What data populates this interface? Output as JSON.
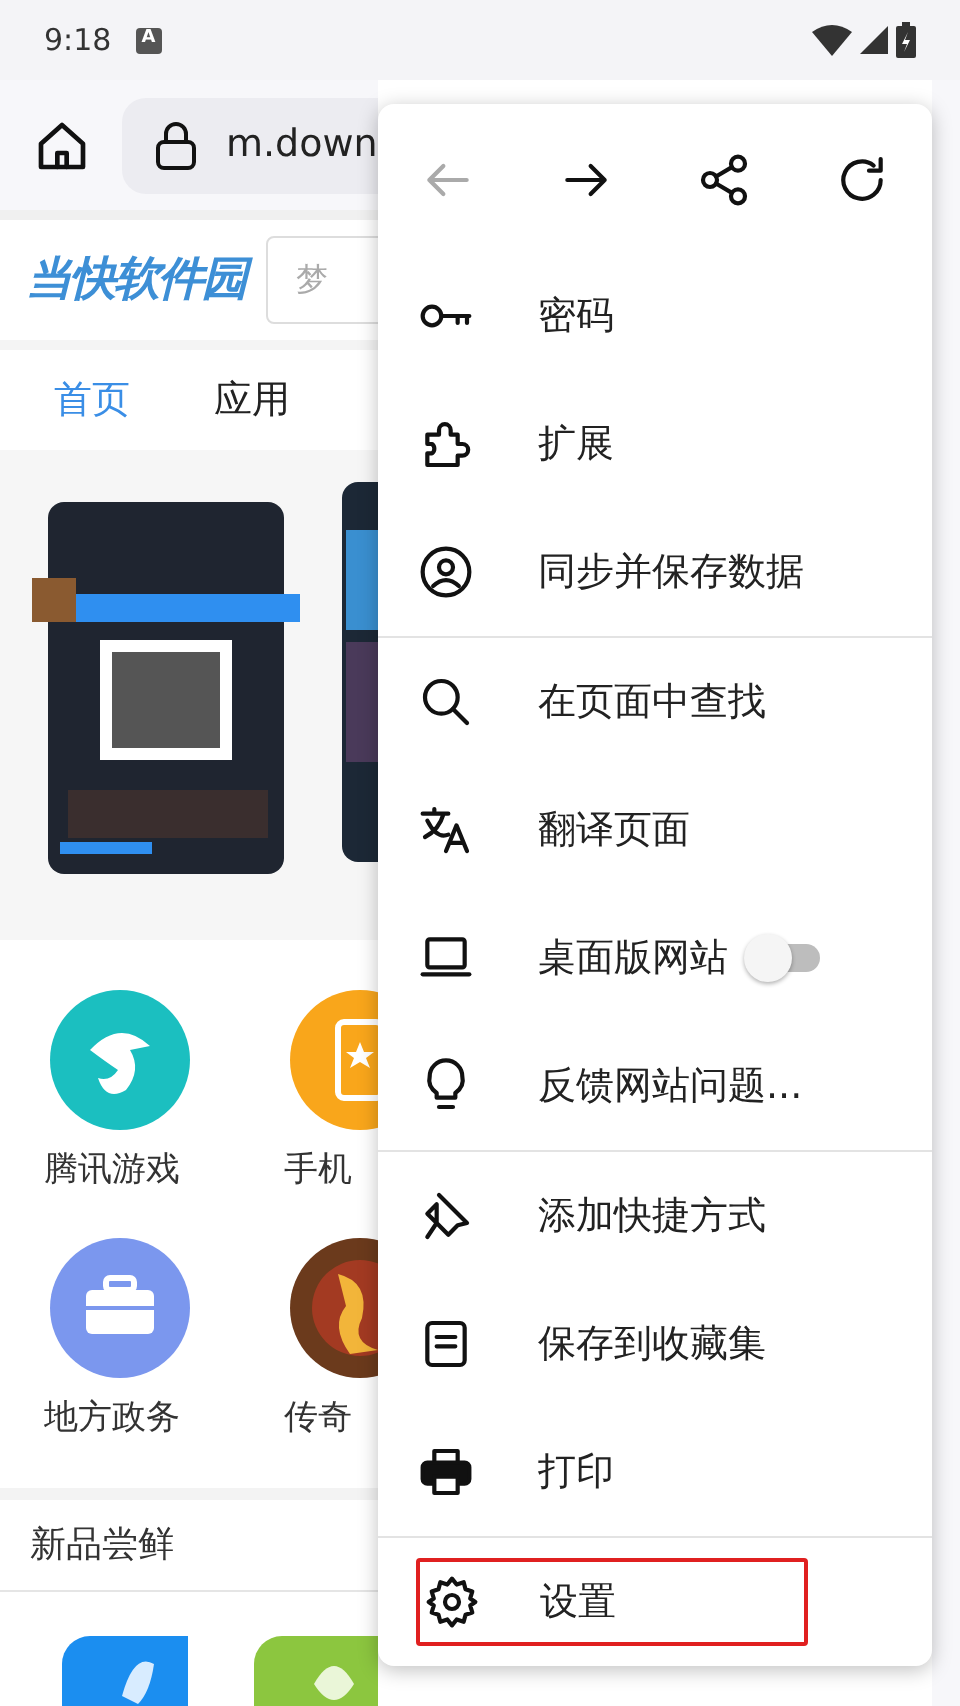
{
  "status_bar": {
    "time": "9:18",
    "notification": "A"
  },
  "toolbar": {
    "url": "m.down"
  },
  "site": {
    "logo": "当快软件园",
    "search_placeholder": "梦"
  },
  "tabs": [
    {
      "label": "首页",
      "selected": true
    },
    {
      "label": "应用",
      "selected": false
    }
  ],
  "categories": [
    {
      "label": "腾讯游戏",
      "color": "#1bbfc0",
      "kind": "fish"
    },
    {
      "label": "手机",
      "color": "#f9a61b",
      "kind": "phone"
    },
    {
      "label": "地方政务",
      "color": "#7b97ee",
      "kind": "briefcase"
    },
    {
      "label": "传奇",
      "color": "#6b3a1c",
      "kind": "picture"
    }
  ],
  "section_title": "新品尝鲜",
  "menu": {
    "nav": [
      {
        "kind": "back",
        "disabled": true
      },
      {
        "kind": "forward",
        "disabled": false
      },
      {
        "kind": "share",
        "disabled": false
      },
      {
        "kind": "reload",
        "disabled": false
      }
    ],
    "groups": [
      [
        {
          "kind": "key",
          "label": "密码"
        },
        {
          "kind": "puzzle",
          "label": "扩展"
        },
        {
          "kind": "account",
          "label": "同步并保存数据"
        }
      ],
      [
        {
          "kind": "search",
          "label": "在页面中查找"
        },
        {
          "kind": "translate",
          "label": "翻译页面"
        },
        {
          "kind": "laptop",
          "label": "桌面版网站",
          "toggle": {
            "on": false
          }
        },
        {
          "kind": "bulb",
          "label": "反馈网站问题..."
        }
      ],
      [
        {
          "kind": "pin",
          "label": "添加快捷方式"
        },
        {
          "kind": "collection",
          "label": "保存到收藏集"
        },
        {
          "kind": "print",
          "label": "打印"
        }
      ],
      [
        {
          "kind": "gear",
          "label": "设置",
          "highlighted": true
        }
      ]
    ]
  }
}
